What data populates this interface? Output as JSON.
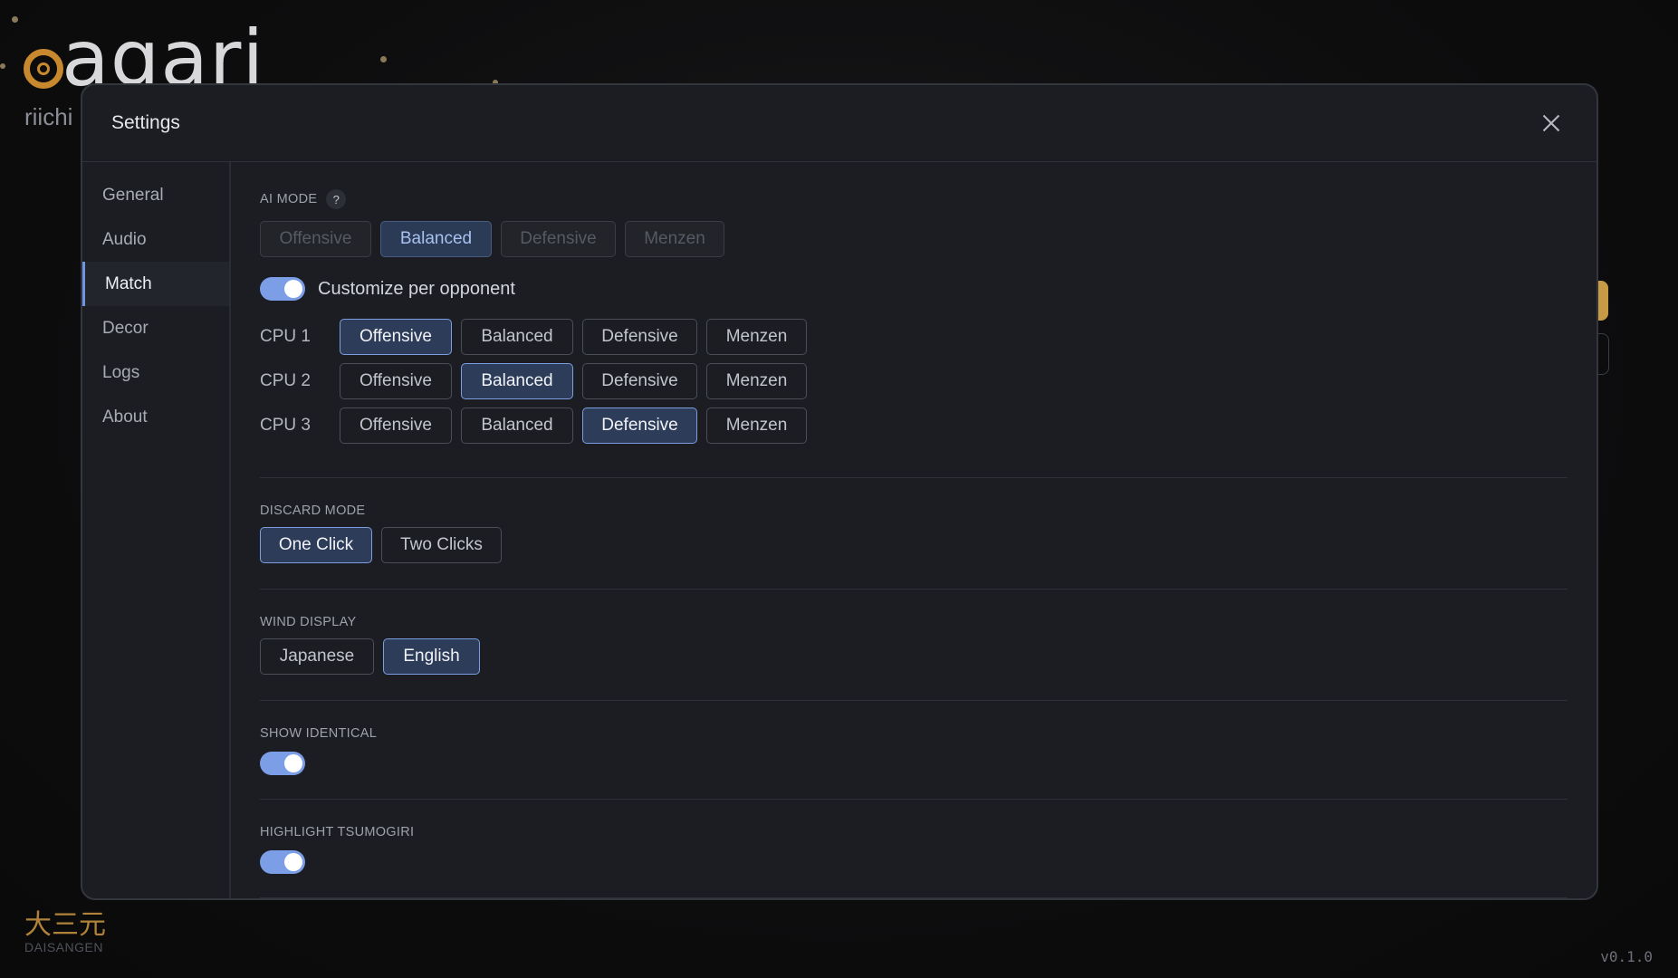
{
  "background": {
    "logo_text": "agari",
    "subtitle": "riichi",
    "kanji": "大三元",
    "kanji_sub": "DAISANGEN",
    "version": "v0.1.0"
  },
  "modal": {
    "title": "Settings",
    "nav": [
      {
        "label": "General",
        "active": false
      },
      {
        "label": "Audio",
        "active": false
      },
      {
        "label": "Match",
        "active": true
      },
      {
        "label": "Decor",
        "active": false
      },
      {
        "label": "Logs",
        "active": false
      },
      {
        "label": "About",
        "active": false
      }
    ]
  },
  "ai_mode": {
    "label": "AI MODE",
    "help": "?",
    "options": [
      "Offensive",
      "Balanced",
      "Defensive",
      "Menzen"
    ],
    "selected": "Balanced",
    "customize_label": "Customize per opponent",
    "customize_enabled": true,
    "cpus": [
      {
        "label": "CPU 1",
        "selected": "Offensive"
      },
      {
        "label": "CPU 2",
        "selected": "Balanced"
      },
      {
        "label": "CPU 3",
        "selected": "Defensive"
      }
    ]
  },
  "discard_mode": {
    "label": "DISCARD MODE",
    "options": [
      "One Click",
      "Two Clicks"
    ],
    "selected": "One Click"
  },
  "wind_display": {
    "label": "WIND DISPLAY",
    "options": [
      "Japanese",
      "English"
    ],
    "selected": "English"
  },
  "show_identical": {
    "label": "SHOW IDENTICAL",
    "enabled": true
  },
  "highlight_tsumogiri": {
    "label": "HIGHLIGHT TSUMOGIRI",
    "enabled": true
  },
  "colors": {
    "accent": "#7c9ee6",
    "gold": "#c8892e"
  }
}
